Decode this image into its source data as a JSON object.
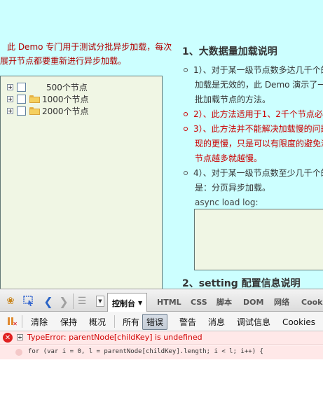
{
  "intro": {
    "line1": "此 Demo 专门用于测试分批异步加载，每次",
    "line2": "展开节点都要重新进行异步加载。"
  },
  "tree": {
    "nodes": [
      {
        "label": "500个节点"
      },
      {
        "label": "1000个节点"
      },
      {
        "label": "2000个节点"
      }
    ]
  },
  "section1": {
    "title": "1、大数据量加载说明",
    "item1_line1": "1）、对于某一级节点数多达几千个的",
    "item1_line2": "加载是无效的，此 Demo 演示了一",
    "item1_line3": "批加载节点的方法。",
    "item2_line1": "2）、此方法适用于1、2千个节点必须",
    "item3_line1": "3）、此方法并不能解决加载慢的问题",
    "item3_line2": "现的更慢，只是可以有限度的避免浏",
    "item3_line3": "节点越多就越慢。",
    "item4_line1": "4）、对于某一级节点数至少几千个的",
    "item4_line2": "是：分页异步加载。",
    "log_label": "async load log:"
  },
  "section2": {
    "title": "2、setting 配置信息说明"
  },
  "firebug": {
    "tabs": {
      "console": "控制台",
      "html": "HTML",
      "css": "CSS",
      "script": "脚本",
      "dom": "DOM",
      "net": "网络",
      "cookies": "Cooki"
    },
    "buttons": {
      "clear": "清除",
      "persist": "保持",
      "profile": "概况",
      "all": "所有",
      "errors": "错误",
      "warnings": "警告",
      "info": "消息",
      "debug": "调试信息",
      "cookies": "Cookies"
    },
    "console": {
      "error_message": "TypeError: parentNode[childKey] is undefined",
      "code_line": "for (var i = 0, l = parentNode[childKey].length; i < l; i++) {"
    }
  }
}
